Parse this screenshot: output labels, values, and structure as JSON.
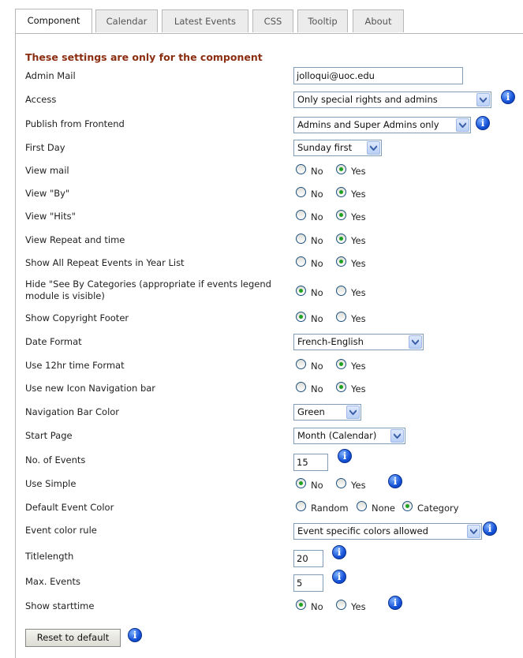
{
  "tabs": [
    "Component",
    "Calendar",
    "Latest Events",
    "CSS",
    "Tooltip",
    "About"
  ],
  "heading": "These settings are only for the component",
  "labels": {
    "admin_mail": "Admin Mail",
    "access": "Access",
    "publish_frontend": "Publish from Frontend",
    "first_day": "First Day",
    "view_mail": "View mail",
    "view_by": "View \"By\"",
    "view_hits": "View \"Hits\"",
    "view_repeat": "View Repeat and time",
    "show_all_repeat": "Show All Repeat Events in Year List",
    "hide_see_by": "Hide \"See By Categories (appropriate if events legend module is visible)",
    "show_copyright": "Show Copyright Footer",
    "date_format": "Date Format",
    "use_12hr": "Use 12hr time Format",
    "use_icon_nav": "Use new Icon Navigation bar",
    "nav_color": "Navigation Bar Color",
    "start_page": "Start Page",
    "num_events": "No. of Events",
    "use_simple": "Use Simple",
    "default_color": "Default Event Color",
    "color_rule": "Event color rule",
    "titlelength": "Titlelength",
    "max_events": "Max. Events",
    "show_starttime": "Show starttime"
  },
  "values": {
    "admin_mail": "jolloqui@uoc.edu",
    "access": "Only special rights and admins",
    "publish_frontend": "Admins and Super Admins only",
    "first_day": "Sunday first",
    "date_format": "French-English",
    "nav_color": "Green",
    "start_page": "Month (Calendar)",
    "num_events": "15",
    "color_rule": "Event specific colors allowed",
    "titlelength": "20",
    "max_events": "5"
  },
  "radio": {
    "no": "No",
    "yes": "Yes",
    "random": "Random",
    "none": "None",
    "category": "Category"
  },
  "info_glyph": "i",
  "reset_button": "Reset to default"
}
